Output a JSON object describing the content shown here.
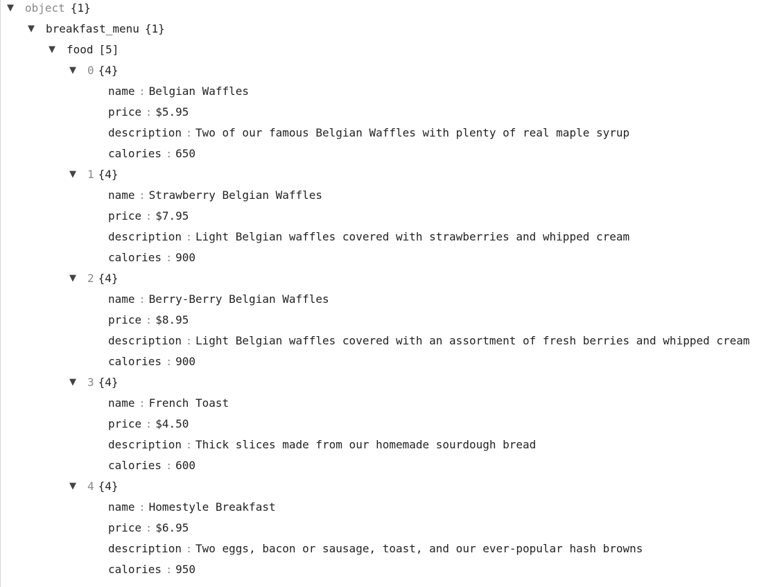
{
  "root": {
    "key": "object",
    "count": "{1}"
  },
  "menu": {
    "key": "breakfast_menu",
    "count": "{1}"
  },
  "food": {
    "key": "food",
    "count": "[5]"
  },
  "separator": ":",
  "items": [
    {
      "index": "0",
      "count": "{4}",
      "fields": [
        {
          "key": "name",
          "value": "Belgian Waffles"
        },
        {
          "key": "price",
          "value": "$5.95"
        },
        {
          "key": "description",
          "value": "Two of our famous Belgian Waffles with plenty of real maple syrup"
        },
        {
          "key": "calories",
          "value": "650"
        }
      ]
    },
    {
      "index": "1",
      "count": "{4}",
      "fields": [
        {
          "key": "name",
          "value": "Strawberry Belgian Waffles"
        },
        {
          "key": "price",
          "value": "$7.95"
        },
        {
          "key": "description",
          "value": "Light Belgian waffles covered with strawberries and whipped cream"
        },
        {
          "key": "calories",
          "value": "900"
        }
      ]
    },
    {
      "index": "2",
      "count": "{4}",
      "fields": [
        {
          "key": "name",
          "value": "Berry-Berry Belgian Waffles"
        },
        {
          "key": "price",
          "value": "$8.95"
        },
        {
          "key": "description",
          "value": "Light Belgian waffles covered with an assortment of fresh berries and whipped cream"
        },
        {
          "key": "calories",
          "value": "900"
        }
      ]
    },
    {
      "index": "3",
      "count": "{4}",
      "fields": [
        {
          "key": "name",
          "value": "French Toast"
        },
        {
          "key": "price",
          "value": "$4.50"
        },
        {
          "key": "description",
          "value": "Thick slices made from our homemade sourdough bread"
        },
        {
          "key": "calories",
          "value": "600"
        }
      ]
    },
    {
      "index": "4",
      "count": "{4}",
      "fields": [
        {
          "key": "name",
          "value": "Homestyle Breakfast"
        },
        {
          "key": "price",
          "value": "$6.95"
        },
        {
          "key": "description",
          "value": "Two eggs, bacon or sausage, toast, and our ever-popular hash browns"
        },
        {
          "key": "calories",
          "value": "950"
        }
      ]
    }
  ]
}
